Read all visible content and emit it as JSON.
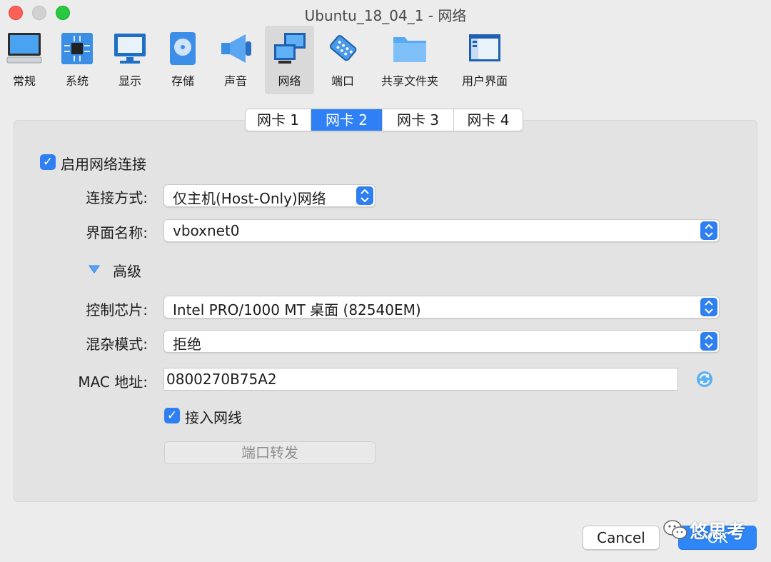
{
  "window": {
    "title": "Ubuntu_18_04_1 - 网络"
  },
  "toolbar": {
    "items": [
      {
        "label": "常规",
        "icon": "monitor-icon"
      },
      {
        "label": "系统",
        "icon": "chip-icon"
      },
      {
        "label": "显示",
        "icon": "display-icon"
      },
      {
        "label": "存储",
        "icon": "disk-icon"
      },
      {
        "label": "声音",
        "icon": "speaker-icon"
      },
      {
        "label": "网络",
        "icon": "network-icon",
        "active": true
      },
      {
        "label": "端口",
        "icon": "serial-port-icon"
      },
      {
        "label": "共享文件夹",
        "icon": "folder-icon"
      },
      {
        "label": "用户界面",
        "icon": "window-icon"
      }
    ]
  },
  "tabs": [
    {
      "label": "网卡 1"
    },
    {
      "label": "网卡 2",
      "active": true
    },
    {
      "label": "网卡 3"
    },
    {
      "label": "网卡 4"
    }
  ],
  "form": {
    "enable_label": "启用网络连接",
    "attached_label": "连接方式:",
    "attached_value": "仅主机(Host-Only)网络",
    "name_label": "界面名称:",
    "name_value": "vboxnet0",
    "advanced_label": "高级",
    "adapter_label": "控制芯片:",
    "adapter_value": "Intel PRO/1000 MT 桌面 (82540EM)",
    "promisc_label": "混杂模式:",
    "promisc_value": "拒绝",
    "mac_label": "MAC 地址:",
    "mac_value": "0800270B75A2",
    "cable_label": "接入网线",
    "port_forward_label": "端口转发"
  },
  "buttons": {
    "cancel": "Cancel",
    "ok": "OK"
  },
  "watermark": {
    "text": "悠思考"
  },
  "colors": {
    "accent": "#2f7ff0",
    "close": "#fe5f57",
    "maximize": "#28c840"
  }
}
